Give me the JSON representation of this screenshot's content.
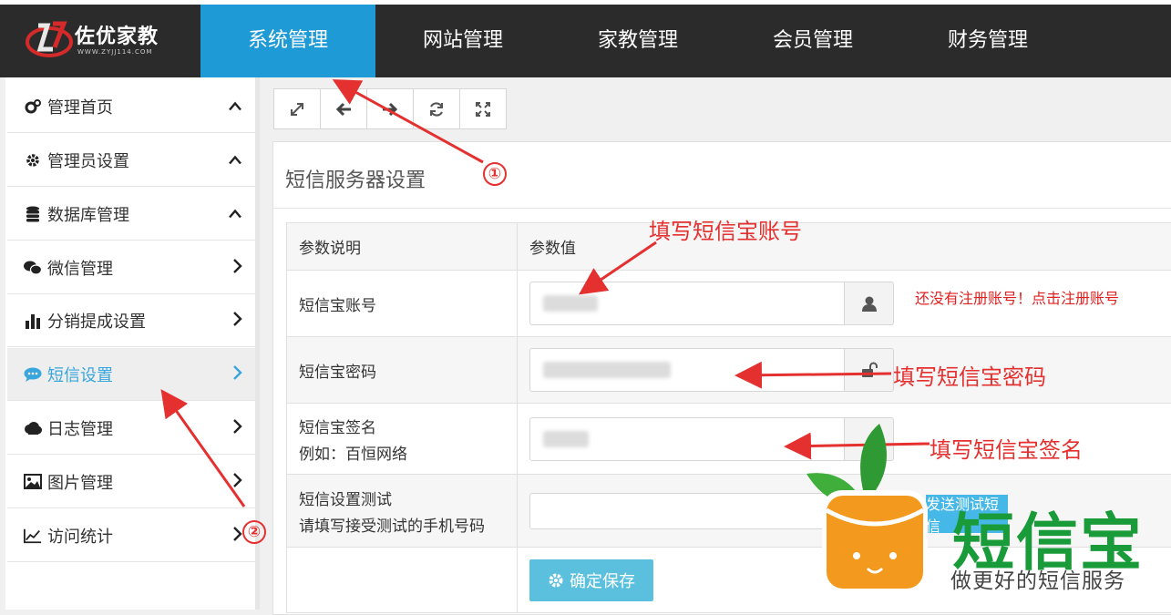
{
  "logo": {
    "name": "佐优家教",
    "url": "WWW.ZYJJ114.COM"
  },
  "nav": {
    "items": [
      "系统管理",
      "网站管理",
      "家教管理",
      "会员管理",
      "财务管理"
    ],
    "active": 0
  },
  "sidebar": {
    "items": [
      {
        "label": "管理首页",
        "icon": "cogs-icon",
        "arrow": "^"
      },
      {
        "label": "管理员设置",
        "icon": "gear-icon",
        "arrow": "^"
      },
      {
        "label": "数据库管理",
        "icon": "database-icon",
        "arrow": "^"
      },
      {
        "label": "微信管理",
        "icon": "wechat-icon",
        "arrow": ">"
      },
      {
        "label": "分销提成设置",
        "icon": "bar-chart-icon",
        "arrow": ">"
      },
      {
        "label": "短信设置",
        "icon": "comment-icon",
        "arrow": ">"
      },
      {
        "label": "日志管理",
        "icon": "cloud-icon",
        "arrow": ">"
      },
      {
        "label": "图片管理",
        "icon": "image-icon",
        "arrow": ">"
      },
      {
        "label": "访问统计",
        "icon": "line-chart-icon",
        "arrow": ">"
      }
    ],
    "active": 5
  },
  "panel": {
    "title": "短信服务器设置",
    "header": {
      "col1": "参数说明",
      "col2": "参数值"
    },
    "rows": [
      {
        "label": "短信宝账号"
      },
      {
        "label": "短信宝密码"
      },
      {
        "label": "短信宝签名",
        "hint": "例如：百恒网络"
      },
      {
        "label": "短信设置测试",
        "hint": "请填写接受测试的手机号码"
      }
    ],
    "register_link": "还没有注册账号！点击注册账号",
    "test_button": "发送测试短信",
    "save_button": "确定保存"
  },
  "annotations": {
    "account": "填写短信宝账号",
    "password": "填写短信宝密码",
    "signature": "填写短信宝签名",
    "step1": "①",
    "step2": "②"
  },
  "brand": {
    "name": "短信宝",
    "slogan": "做更好的短信服务"
  },
  "colors": {
    "nav_active": "#1e9ad6",
    "sidebar_active_text": "#38a5dc",
    "save_button": "#5bc0de",
    "annotation": "#e53030",
    "brand_green": "#1a9b3a",
    "brand_orange": "#f39a1e"
  }
}
